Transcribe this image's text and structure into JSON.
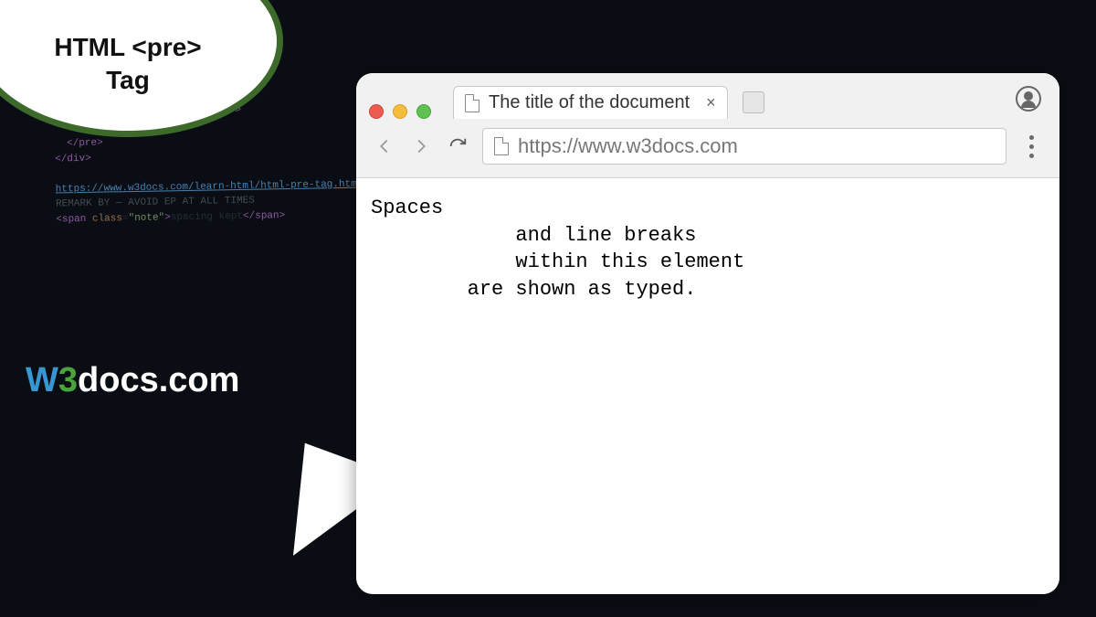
{
  "bubble": {
    "title_line1": "HTML <pre>",
    "title_line2": "Tag"
  },
  "logo": {
    "w": "W",
    "three": "3",
    "rest": "docs.com"
  },
  "browser": {
    "tab": {
      "title": "The title of the document",
      "close_label": "×"
    },
    "url": "https://www.w3docs.com",
    "content": "Spaces\n            and line breaks\n            within this element\n        are shown as typed."
  }
}
